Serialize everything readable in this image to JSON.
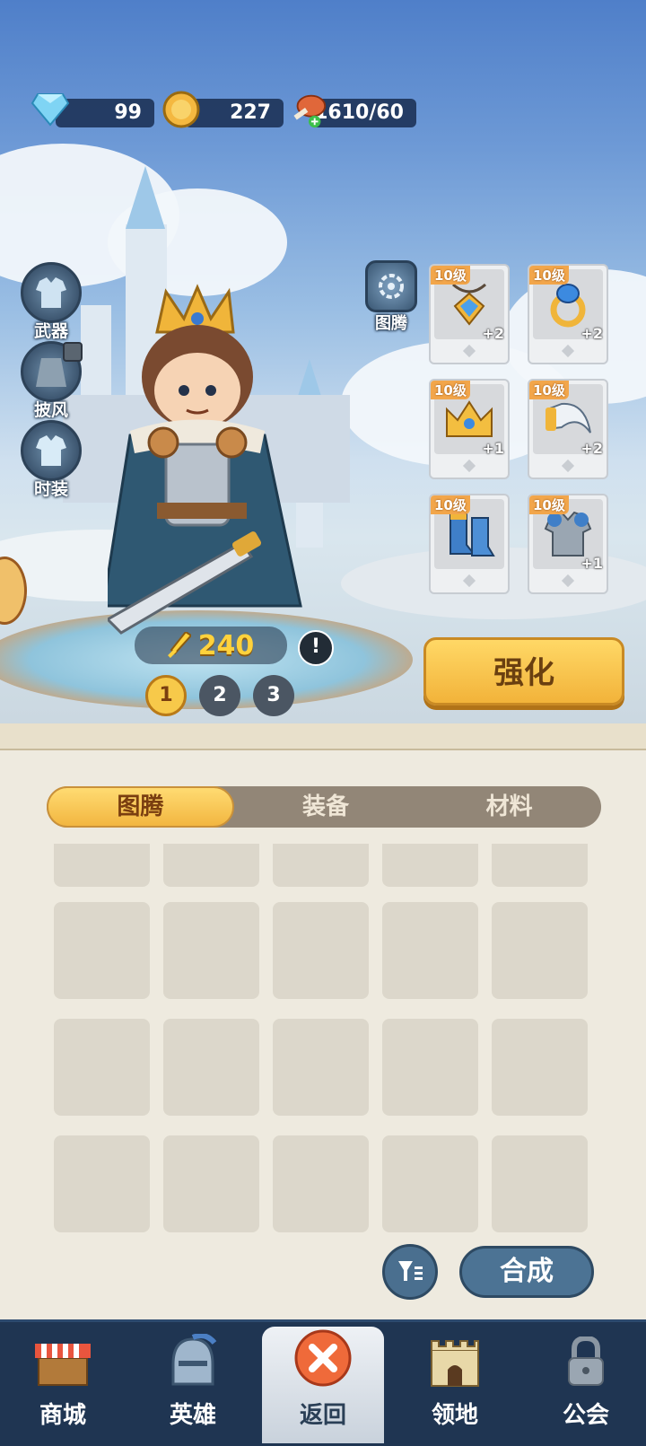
{
  "resources": {
    "diamonds": "99",
    "gold": "227",
    "stamina": "1610/60"
  },
  "side_menu": [
    {
      "label": "武器",
      "icon": "shirt-icon",
      "locked": false
    },
    {
      "label": "披风",
      "icon": "cape-icon",
      "locked": true
    },
    {
      "label": "时装",
      "icon": "outfit-icon",
      "locked": false
    }
  ],
  "totem_label": "图腾",
  "equipment": [
    {
      "level": "10级",
      "item": "amulet",
      "plus": "+2"
    },
    {
      "level": "10级",
      "item": "ring",
      "plus": "+2"
    },
    {
      "level": "10级",
      "item": "crown",
      "plus": "+1"
    },
    {
      "level": "10级",
      "item": "horn",
      "plus": "+2"
    },
    {
      "level": "10级",
      "item": "boots",
      "plus": ""
    },
    {
      "level": "10级",
      "item": "chest-armor",
      "plus": "+1"
    }
  ],
  "power": "240",
  "alert_symbol": "!",
  "pages": [
    "1",
    "2",
    "3"
  ],
  "strengthen_label": "强化",
  "tabs": [
    "图腾",
    "装备",
    "材料"
  ],
  "filter_icon": "filter-icon",
  "compose_label": "合成",
  "nav": [
    {
      "label": "商城",
      "icon": "shop-icon"
    },
    {
      "label": "英雄",
      "icon": "helmet-icon"
    },
    {
      "label": "返回",
      "icon": "close-icon"
    },
    {
      "label": "领地",
      "icon": "castle-icon"
    },
    {
      "label": "公会",
      "icon": "lock-icon"
    }
  ],
  "colors": {
    "accent_gold": "#f2b640",
    "nav_bg": "#1f3552",
    "panel_bg": "#eeeadf"
  }
}
